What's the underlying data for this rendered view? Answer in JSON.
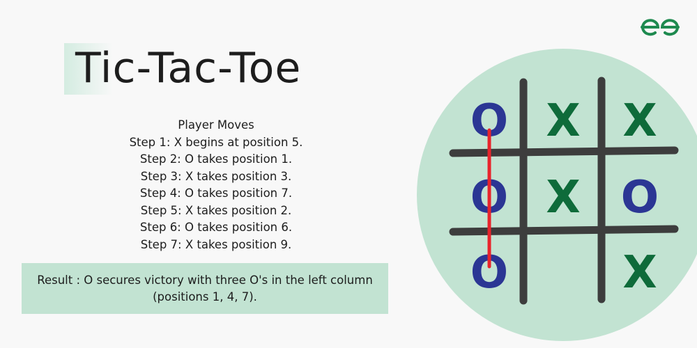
{
  "title": "Tic-Tac-Toe",
  "moves": {
    "heading": "Player Moves",
    "steps": [
      "Step 1: X begins at position 5.",
      "Step 2: O takes position 1.",
      "Step 3: X takes position 3.",
      "Step 4: O takes position 7.",
      "Step 5: X takes position 2.",
      "Step 6: O takes position 6.",
      "Step 7: X takes position 9."
    ]
  },
  "result": {
    "line1": "Result : O secures victory with three O's in the left column",
    "line2": "(positions 1, 4, 7)."
  },
  "logo": {
    "icon": "geeksforgeeks-logo-icon",
    "color": "#1e8a4f"
  },
  "board": {
    "cells": [
      "O",
      "X",
      "X",
      "O",
      "X",
      "O",
      "O",
      "",
      "X"
    ],
    "winning_line": [
      1,
      4,
      7
    ],
    "colors": {
      "x": "#0e6b3a",
      "o": "#2b3694",
      "grid": "#3d3d3d",
      "win_line": "#e8242c",
      "circle": "#c2e3d2"
    }
  }
}
